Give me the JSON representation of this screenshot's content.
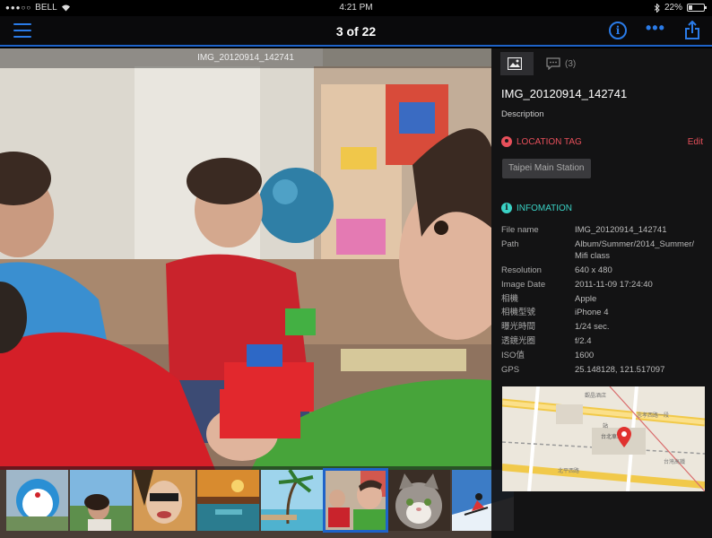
{
  "status": {
    "carrier": "BELL",
    "time": "4:21 PM",
    "battery": "22%",
    "battery_level": 0.22
  },
  "nav": {
    "title": "3 of 22"
  },
  "photo": {
    "title": "IMG_20120914_142741"
  },
  "thumbnails": [
    {
      "name": "doraemon"
    },
    {
      "name": "woman-outdoor"
    },
    {
      "name": "sunglasses"
    },
    {
      "name": "sunset-pool"
    },
    {
      "name": "palm-beach"
    },
    {
      "name": "kids-playing",
      "active": true
    },
    {
      "name": "kitten"
    },
    {
      "name": "skier"
    }
  ],
  "panel": {
    "tabs": [
      {
        "label": ""
      },
      {
        "label": "(3)"
      }
    ],
    "title": "IMG_20120914_142741",
    "description": "Description",
    "location": {
      "header": "LOCATION TAG",
      "edit": "Edit",
      "tag": "Taipei Main Station"
    },
    "info": {
      "header": "INFOMATION",
      "rows": [
        {
          "k": "File name",
          "v": "IMG_20120914_142741"
        },
        {
          "k": "Path",
          "v": "Album/Summer/2014_Summer/ Mifi class"
        },
        {
          "k": "Resolution",
          "v": "640 x 480"
        },
        {
          "k": "Image Date",
          "v": "2011-11-09 17:24:40"
        },
        {
          "k": "相機",
          "v": "Apple"
        },
        {
          "k": "相機型號",
          "v": "iPhone 4"
        },
        {
          "k": "曝光時間",
          "v": "1/24 sec."
        },
        {
          "k": "透鏡光圈",
          "v": "f/2.4"
        },
        {
          "k": "ISO值",
          "v": "1600"
        },
        {
          "k": "GPS",
          "v": "25.148128, 121.517097"
        }
      ]
    },
    "map": {
      "labels": [
        "觀晶酒店",
        "忠孝西路一段",
        "台北車站",
        "北平西路",
        "台灣高鐵",
        "站"
      ]
    }
  },
  "colors": {
    "accent": "#2a7be8",
    "location": "#e8505b",
    "info": "#3ad2c5"
  }
}
